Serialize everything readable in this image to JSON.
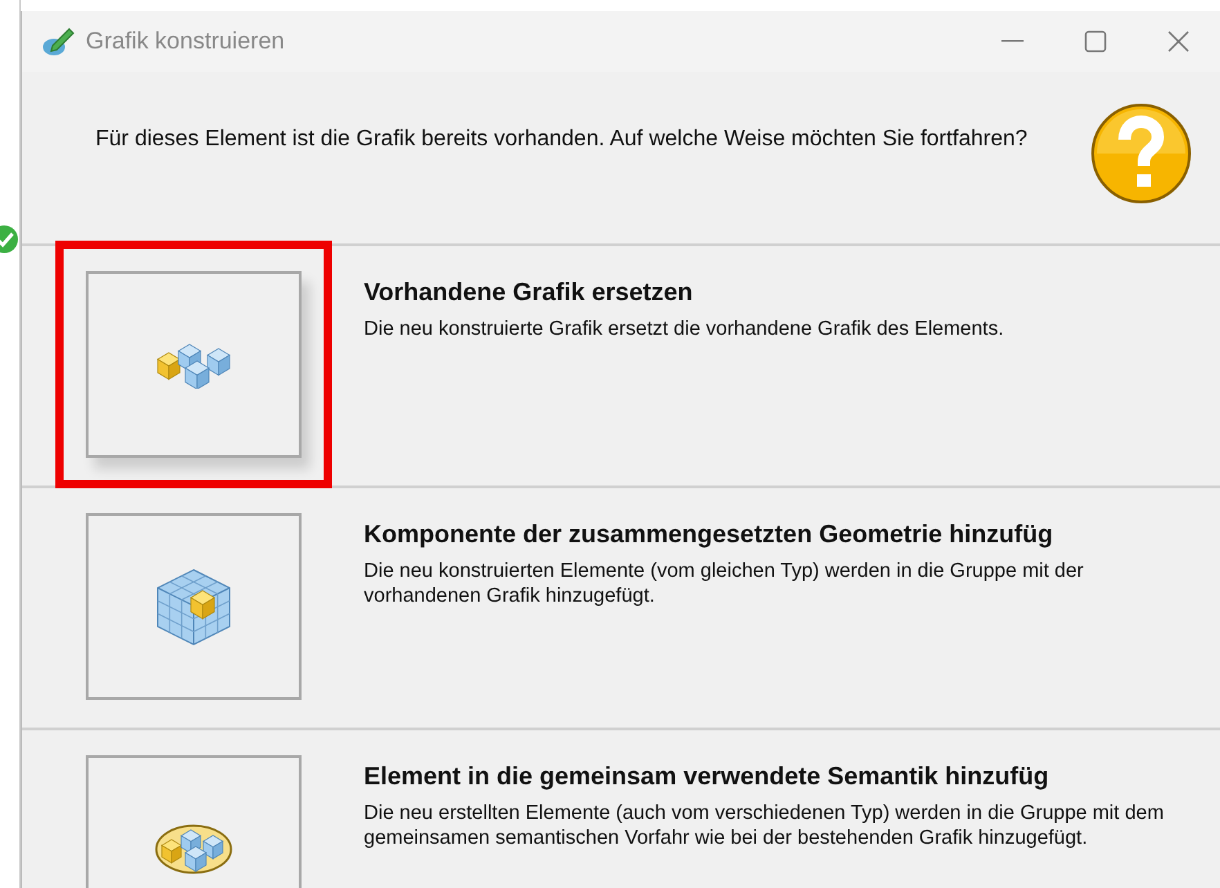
{
  "window": {
    "title": "Grafik konstruieren"
  },
  "message": "Für dieses Element ist die Grafik bereits vorhanden. Auf welche Weise möchten Sie fortfahren?",
  "options": [
    {
      "kind": "replace",
      "title": "Vorhandene Grafik ersetzen",
      "description": "Die neu konstruierte Grafik ersetzt die vorhandene Grafik des Elements.",
      "highlighted": true
    },
    {
      "kind": "component",
      "title": "Komponente der zusammengesetzten Geometrie hinzufüg",
      "description": "Die neu konstruierten Elemente (vom gleichen Typ) werden in die Gruppe mit der vorhandenen Grafik hinzugefügt.",
      "highlighted": false
    },
    {
      "kind": "semantic",
      "title": "Element in die gemeinsam verwendete Semantik hinzufüg",
      "description": "Die neu erstellten Elemente (auch vom verschiedenen Typ) werden in die Gruppe mit dem gemeinsamen semantischen Vorfahr wie bei der bestehenden Grafik hinzugefügt.",
      "highlighted": false
    }
  ]
}
